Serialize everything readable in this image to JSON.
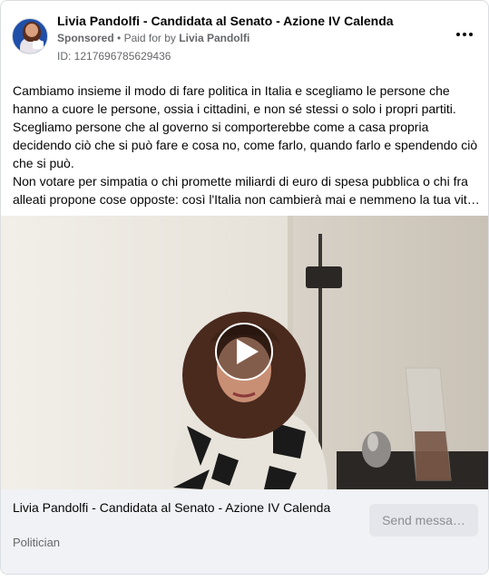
{
  "header": {
    "page_name": "Livia Pandolfi - Candidata al Senato - Azione IV Calenda",
    "sponsored": "Sponsored",
    "separator": "•",
    "paid_for_prefix": "Paid for by",
    "payer": "Livia Pandolfi",
    "ad_id": "ID: 1217696785629436",
    "more_icon": "more-horizontal-icon"
  },
  "ad_text": [
    "Cambiamo insieme il modo di fare politica in Italia e scegliamo le persone che",
    "hanno a cuore le persone, ossia i cittadini, e non sé stessi o solo i propri partiti.",
    "Scegliamo persone che al governo si comporterebbe come a casa propria",
    "decidendo ciò che si può fare e cosa no, come farlo, quando farlo e spendendo ciò",
    "che si può.",
    "Non votare per simpatia o chi promette miliardi di euro di spesa pubblica o chi fra",
    "alleati propone cose opposte: così l'Italia non cambierà mai e nemmeno la tua vit…"
  ],
  "video": {
    "play_icon": "play-icon"
  },
  "footer": {
    "title": "Livia Pandolfi - Candidata al Senato - Azione IV Calenda",
    "category": "Politician",
    "cta_label": "Send messa…"
  },
  "colors": {
    "text_primary": "#050505",
    "text_secondary": "#65676b",
    "footer_bg": "#f0f2f5",
    "button_bg": "#e4e6eb"
  }
}
